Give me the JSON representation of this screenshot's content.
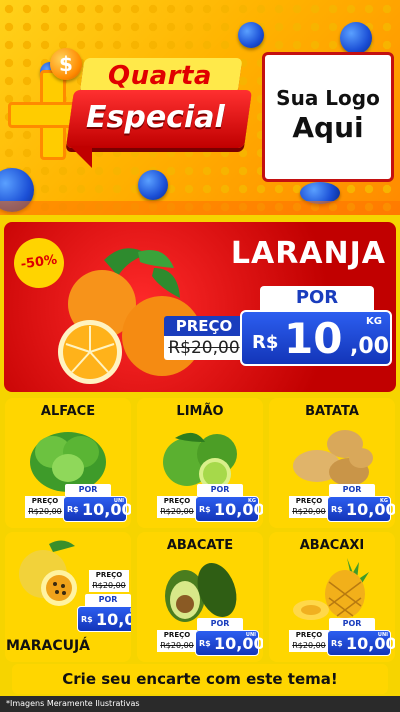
{
  "header": {
    "dollar_symbol": "$",
    "plus_symbol": "+",
    "title_line1": "Quarta",
    "title_line2": "Especial",
    "logo_line1": "Sua Logo",
    "logo_line2": "Aqui"
  },
  "hero": {
    "product": "LARANJA",
    "discount": "-50%",
    "por_label": "POR",
    "preco_label": "PREÇO",
    "old_price": "R$20,00",
    "currency": "R$",
    "price_integer": "10",
    "price_decimal": ",00",
    "unit": "KG"
  },
  "products": [
    {
      "name": "ALFACE",
      "por": "POR",
      "preco": "PREÇO",
      "old": "R$20,00",
      "currency": "R$",
      "price": "10,00",
      "unit": "UNI"
    },
    {
      "name": "LIMÃO",
      "por": "POR",
      "preco": "PREÇO",
      "old": "R$20,00",
      "currency": "R$",
      "price": "10,00",
      "unit": "KG"
    },
    {
      "name": "BATATA",
      "por": "POR",
      "preco": "PREÇO",
      "old": "R$20,00",
      "currency": "R$",
      "price": "10,00",
      "unit": "KG"
    },
    {
      "name": "MARACUJÁ",
      "por": "POR",
      "preco": "PREÇO",
      "old": "R$20,00",
      "currency": "R$",
      "price": "10,00",
      "unit": "KG"
    },
    {
      "name": "ABACATE",
      "por": "POR",
      "preco": "PREÇO",
      "old": "R$20,00",
      "currency": "R$",
      "price": "10,00",
      "unit": "UNI"
    },
    {
      "name": "ABACAXI",
      "por": "POR",
      "preco": "PREÇO",
      "old": "R$20,00",
      "currency": "R$",
      "price": "10,00",
      "unit": "UNI"
    }
  ],
  "cta": "Crie seu encarte com este tema!",
  "footer": "*Imagens Meramente Ilustrativas",
  "colors": {
    "red": "#c10000",
    "yellow": "#ffd600",
    "blue": "#1a3dbd"
  }
}
